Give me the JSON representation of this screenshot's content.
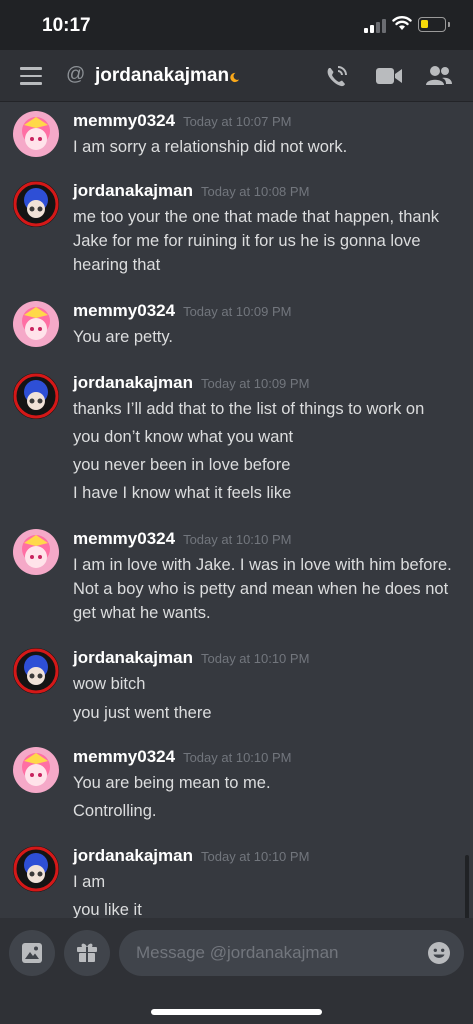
{
  "status_bar": {
    "time": "10:17",
    "icons": [
      "cellular-signal-icon",
      "wifi-icon",
      "battery-icon"
    ],
    "battery_level": 0.3
  },
  "header": {
    "at_symbol": "@",
    "title": "jordanakajman",
    "status": "idle-moon-icon",
    "icons": [
      "menu-icon",
      "voice-call-icon",
      "video-call-icon",
      "members-icon"
    ]
  },
  "messages": [
    {
      "username": "memmy0324",
      "timestamp": "Today at 10:07 PM",
      "avatar": "pink-avatar",
      "lines": [
        "I am sorry a relationship did not work."
      ]
    },
    {
      "username": "jordanakajman",
      "timestamp": "Today at 10:08 PM",
      "avatar": "blue-avatar",
      "lines": [
        "me too your the one that made that happen, thank Jake for me for ruining it for us he is gonna love hearing that"
      ]
    },
    {
      "username": "memmy0324",
      "timestamp": "Today at 10:09 PM",
      "avatar": "pink-avatar",
      "lines": [
        "You are petty."
      ]
    },
    {
      "username": "jordanakajman",
      "timestamp": "Today at 10:09 PM",
      "avatar": "blue-avatar",
      "lines": [
        "thanks I’ll add that to the list of things to work on",
        "you don’t know what you want",
        "you never been in love before",
        "I have I know what it feels like"
      ]
    },
    {
      "username": "memmy0324",
      "timestamp": "Today at 10:10 PM",
      "avatar": "pink-avatar",
      "lines": [
        "I am in love with Jake. I was in love with him before. Not a boy who is petty and mean when he does not get what he wants."
      ]
    },
    {
      "username": "jordanakajman",
      "timestamp": "Today at 10:10 PM",
      "avatar": "blue-avatar",
      "lines": [
        "wow bitch",
        "you just went there"
      ]
    },
    {
      "username": "memmy0324",
      "timestamp": "Today at 10:10 PM",
      "avatar": "pink-avatar",
      "lines": [
        "You are being mean to me.",
        "Controlling."
      ]
    },
    {
      "username": "jordanakajman",
      "timestamp": "Today at 10:10 PM",
      "avatar": "blue-avatar",
      "lines": [
        "I am",
        "you like it"
      ]
    }
  ],
  "composer": {
    "placeholder": "Message @jordanakajman",
    "icons": [
      "image-icon",
      "gift-icon",
      "emoji-icon"
    ]
  },
  "colors": {
    "background": "#36393f",
    "header": "#2f3136",
    "status_bar": "#202225",
    "input": "#40444b",
    "text": "#dcddde",
    "muted": "#72767d",
    "idle": "#faa81a",
    "battery": "#f5d90a"
  }
}
